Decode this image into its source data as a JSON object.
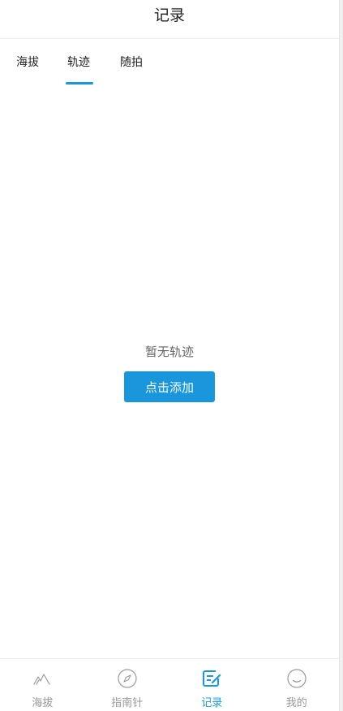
{
  "header": {
    "title": "记录"
  },
  "tabs": [
    {
      "label": "海拔",
      "active": false
    },
    {
      "label": "轨迹",
      "active": true
    },
    {
      "label": "随拍",
      "active": false
    }
  ],
  "empty_state": {
    "message": "暂无轨迹",
    "button_label": "点击添加"
  },
  "tabbar": [
    {
      "label": "海拔",
      "icon": "mountain-icon",
      "active": false
    },
    {
      "label": "指南针",
      "icon": "compass-icon",
      "active": false
    },
    {
      "label": "记录",
      "icon": "edit-note-icon",
      "active": true
    },
    {
      "label": "我的",
      "icon": "smile-icon",
      "active": false
    }
  ],
  "colors": {
    "accent": "#1a96dc",
    "inactive": "#999999",
    "text": "#222222"
  }
}
